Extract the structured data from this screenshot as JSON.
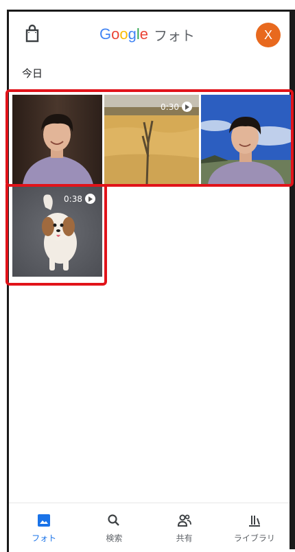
{
  "header": {
    "title_google_letters": [
      {
        "ch": "G",
        "color": "#4285F4"
      },
      {
        "ch": "o",
        "color": "#EA4335"
      },
      {
        "ch": "o",
        "color": "#FBBC05"
      },
      {
        "ch": "g",
        "color": "#4285F4"
      },
      {
        "ch": "l",
        "color": "#34A853"
      },
      {
        "ch": "e",
        "color": "#EA4335"
      }
    ],
    "title_suffix": "フォト",
    "avatar_initial": "X",
    "avatar_color": "#e8691e",
    "left_icon": "shopping-bag-icon"
  },
  "section": {
    "title": "今日"
  },
  "photos": [
    {
      "kind": "photo",
      "subject": "portrait-dark-bg"
    },
    {
      "kind": "video",
      "subject": "dry-grass-field",
      "duration": "0:30"
    },
    {
      "kind": "photo",
      "subject": "portrait-sky-bg"
    },
    {
      "kind": "video",
      "subject": "small-dog",
      "duration": "0:38"
    }
  ],
  "highlight_color": "#e1131a",
  "bottom_nav": {
    "items": [
      {
        "label": "フォト",
        "icon": "photo-icon",
        "active": true
      },
      {
        "label": "検索",
        "icon": "search-icon",
        "active": false
      },
      {
        "label": "共有",
        "icon": "people-icon",
        "active": false
      },
      {
        "label": "ライブラリ",
        "icon": "library-icon",
        "active": false
      }
    ],
    "active_color": "#1a73e8"
  }
}
